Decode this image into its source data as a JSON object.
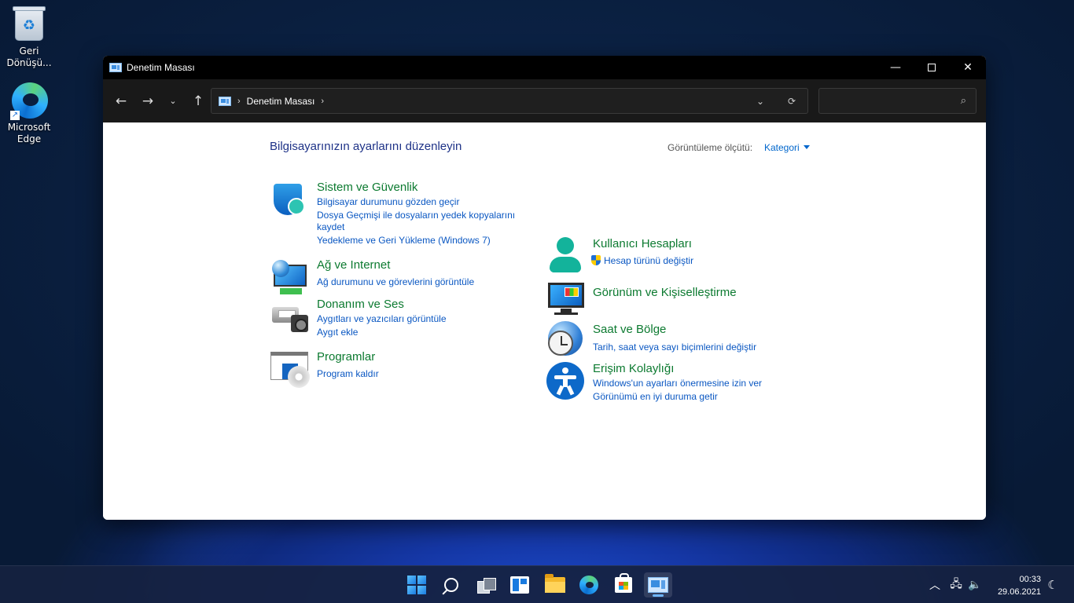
{
  "desktop": {
    "icons": [
      {
        "label": "Geri Dönüşü...",
        "icon": "recycle-bin-icon"
      },
      {
        "label": "Microsoft Edge",
        "icon": "edge-icon"
      }
    ]
  },
  "window": {
    "title": "Denetim Masası",
    "controls": {
      "minimize": "—",
      "close": "✕"
    },
    "nav": {
      "back": "←",
      "forward": "→",
      "recent": "⌄",
      "up": "↑"
    },
    "address": {
      "crumb": "Denetim Masası",
      "sep": "›",
      "dropdown": "⌄",
      "refresh": "⟳"
    },
    "search": {
      "placeholder": "",
      "icon": "⌕"
    }
  },
  "content": {
    "heading": "Bilgisayarınızın ayarlarını düzenleyin",
    "view_by_label": "Görüntüleme ölçütü:",
    "view_by_value": "Kategori",
    "categories_left": [
      {
        "title": "Sistem ve Güvenlik",
        "icon": "shield-icon",
        "links": [
          "Bilgisayar durumunu gözden geçir",
          "Dosya Geçmişi ile dosyaların yedek kopyalarını",
          "kaydet",
          "Yedekleme ve Geri Yükleme (Windows 7)"
        ]
      },
      {
        "title": "Ağ ve Internet",
        "icon": "network-icon",
        "links": [
          "Ağ durumunu ve görevlerini görüntüle"
        ]
      },
      {
        "title": "Donanım ve Ses",
        "icon": "printer-icon",
        "links": [
          "Aygıtları ve yazıcıları görüntüle",
          "Aygıt ekle"
        ]
      },
      {
        "title": "Programlar",
        "icon": "programs-icon",
        "links": [
          "Program kaldır"
        ]
      }
    ],
    "categories_right": [
      {
        "title": "Kullanıcı Hesapları",
        "icon": "user-icon",
        "links": [
          "Hesap türünü değiştir"
        ]
      },
      {
        "title": "Görünüm ve Kişiselleştirme",
        "icon": "monitor-icon",
        "links": []
      },
      {
        "title": "Saat ve Bölge",
        "icon": "clock-globe-icon",
        "links": [
          "Tarih, saat veya sayı biçimlerini değiştir"
        ]
      },
      {
        "title": "Erişim Kolaylığı",
        "icon": "accessibility-icon",
        "links": [
          "Windows'un ayarları önermesine izin ver",
          "Görünümü en iyi duruma getir"
        ]
      }
    ]
  },
  "taskbar": {
    "apps": [
      "start-icon",
      "search-icon",
      "task-view-icon",
      "widgets-icon",
      "file-explorer-icon",
      "edge-icon",
      "store-icon",
      "control-panel-icon"
    ],
    "tray": {
      "chevron": "︿",
      "network": "🖧",
      "volume": "🔈",
      "notification": "☾"
    },
    "time": "00:33",
    "date": "29.06.2021"
  }
}
